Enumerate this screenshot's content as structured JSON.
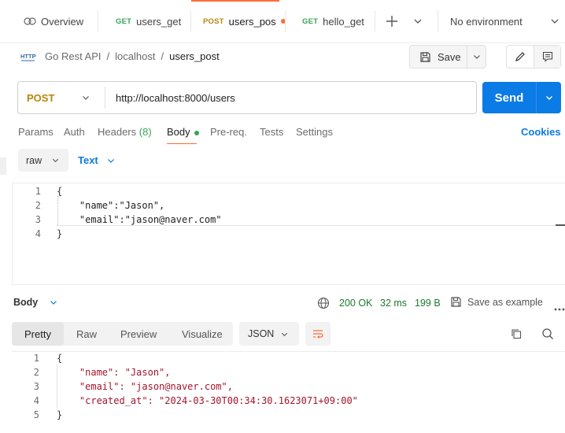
{
  "tabs": [
    {
      "label": "Overview",
      "method": ""
    },
    {
      "label": "users_get",
      "method": "GET"
    },
    {
      "label": "users_pos",
      "method": "POST",
      "active": true,
      "unsaved": true
    },
    {
      "label": "hello_get",
      "method": "GET"
    }
  ],
  "environment": {
    "selected": "No environment"
  },
  "breadcrumb": {
    "badge": "HTTP",
    "collection": "Go Rest API",
    "folder": "localhost",
    "request": "users_post",
    "separator": "/"
  },
  "toolbar": {
    "save_label": "Save"
  },
  "request": {
    "method": "POST",
    "url": "http://localhost:8000/users",
    "send_label": "Send"
  },
  "request_tabs": {
    "params": "Params",
    "auth": "Auth",
    "headers": "Headers",
    "headers_count": "(8)",
    "body": "Body",
    "prereq": "Pre-req.",
    "tests": "Tests",
    "settings": "Settings",
    "cookies": "Cookies"
  },
  "body_options": {
    "mode": "raw",
    "type": "Text"
  },
  "request_body": {
    "line_numbers": [
      "1",
      "2",
      "3",
      "4"
    ],
    "lines": [
      "{",
      "    \"name\":\"Jason\",",
      "    \"email\":\"jason@naver.com\"",
      "}"
    ]
  },
  "response": {
    "section_label": "Body",
    "status": "200 OK",
    "time": "32 ms",
    "size": "199 B",
    "save_example": "Save as example",
    "view_tabs": [
      "Pretty",
      "Raw",
      "Preview",
      "Visualize"
    ],
    "format": "JSON",
    "line_numbers": [
      "1",
      "2",
      "3",
      "4",
      "5"
    ],
    "lines": [
      "{",
      "    \"name\": \"Jason\",",
      "    \"email\": \"jason@naver.com\",",
      "    \"created_at\": \"2024-03-30T00:34:30.1623071+09:00\"",
      "}"
    ]
  },
  "colors": {
    "accent": "#FF6C37",
    "send": "#0B7BE5",
    "get": "#3aa357",
    "post": "#b8860b",
    "status_ok": "#1b7a2f",
    "json_string": "#0d47a1",
    "json_key": "#a3152c"
  }
}
